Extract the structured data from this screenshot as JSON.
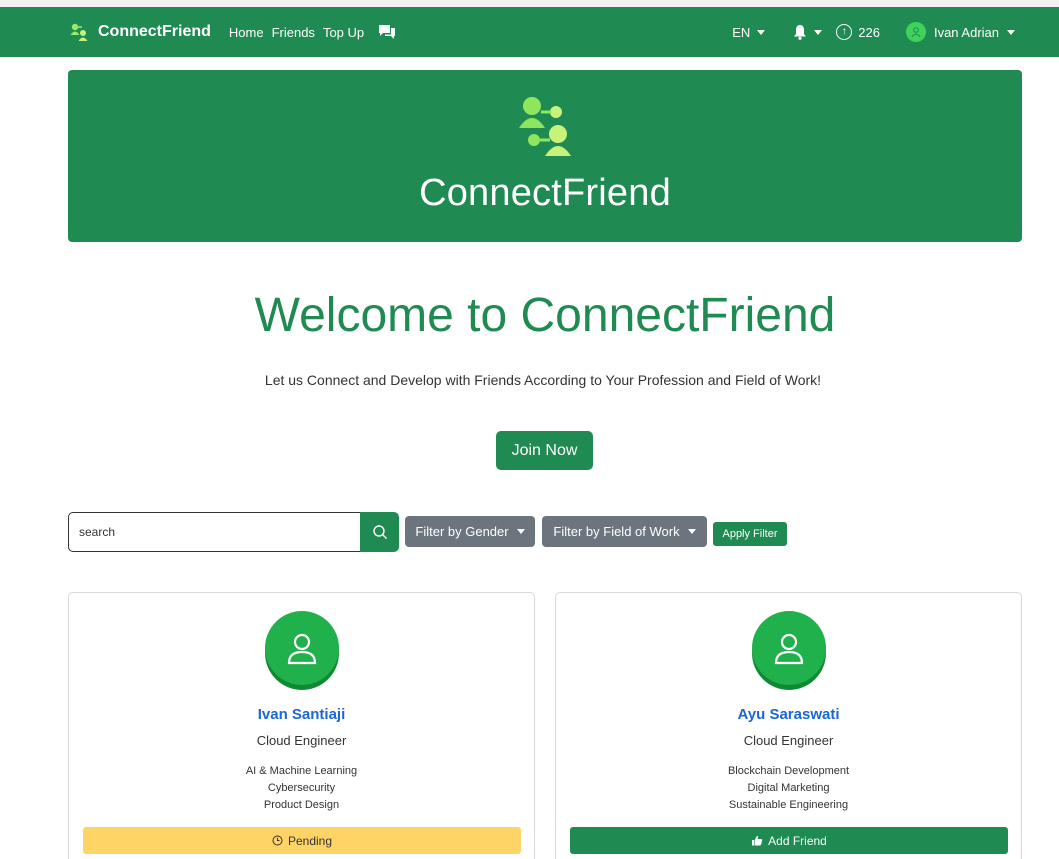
{
  "navbar": {
    "brand": "ConnectFriend",
    "links": [
      "Home",
      "Friends",
      "Top Up"
    ],
    "language": "EN",
    "coins": "226",
    "user_name": "Ivan Adrian"
  },
  "banner": {
    "title": "ConnectFriend"
  },
  "hero": {
    "welcome": "Welcome to ConnectFriend",
    "subtitle": "Let us Connect and Develop with Friends According to Your Profession and Field of Work!",
    "join_label": "Join Now"
  },
  "filters": {
    "search_placeholder": "search",
    "gender_label": "Filter by Gender",
    "work_label": "Filter by Field of Work",
    "apply_label": "Apply Filter"
  },
  "cards": [
    {
      "name": "Ivan Santiaji",
      "role": "Cloud Engineer",
      "fields": [
        "AI & Machine Learning",
        "Cybersecurity",
        "Product Design"
      ],
      "action": "Pending"
    },
    {
      "name": "Ayu Saraswati",
      "role": "Cloud Engineer",
      "fields": [
        "Blockchain Development",
        "Digital Marketing",
        "Sustainable Engineering"
      ],
      "action": "Add Friend"
    }
  ],
  "colors": {
    "brand": "#1f8a52",
    "pending": "#fdd465",
    "link": "#1a67d6"
  }
}
